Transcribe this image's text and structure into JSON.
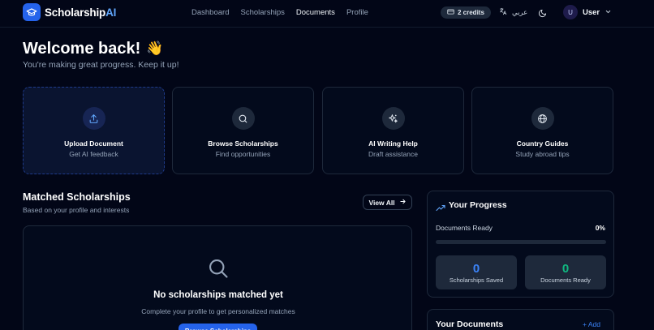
{
  "brand": {
    "name": "Scholarship",
    "suffix": "AI",
    "icon": "graduation-cap-icon",
    "accent": "#2563eb"
  },
  "nav": {
    "links": [
      {
        "label": "Dashboard",
        "active": false
      },
      {
        "label": "Scholarships",
        "active": false
      },
      {
        "label": "Documents",
        "active": true
      },
      {
        "label": "Profile",
        "active": false
      }
    ],
    "credits": "2 credits",
    "language": "عربي",
    "user": {
      "initial": "U",
      "name": "User"
    }
  },
  "welcome": {
    "title": "Welcome back!",
    "emoji": "👋",
    "subtitle": "You're making great progress. Keep it up!"
  },
  "actions": [
    {
      "title": "Upload Document",
      "subtitle": "Get AI feedback",
      "icon": "upload-icon"
    },
    {
      "title": "Browse Scholarships",
      "subtitle": "Find opportunities",
      "icon": "search-icon"
    },
    {
      "title": "AI Writing Help",
      "subtitle": "Draft assistance",
      "icon": "sparkles-icon"
    },
    {
      "title": "Country Guides",
      "subtitle": "Study abroad tips",
      "icon": "globe-icon"
    }
  ],
  "matched": {
    "title": "Matched Scholarships",
    "subtitle": "Based on your profile and interests",
    "view_all": "View All",
    "empty_title": "No scholarships matched yet",
    "empty_subtitle": "Complete your profile to get personalized matches",
    "browse_button": "Browse Scholarships"
  },
  "progress": {
    "title": "Your Progress",
    "docs_ready_label": "Documents Ready",
    "docs_ready_value": "0%",
    "docs_ready_fraction": 0,
    "stats": [
      {
        "value": "0",
        "label": "Scholarships Saved",
        "color": "#3b82f6"
      },
      {
        "value": "0",
        "label": "Documents Ready",
        "color": "#10b981"
      }
    ]
  },
  "documents": {
    "title": "Your Documents",
    "add_label": "+ Add"
  }
}
